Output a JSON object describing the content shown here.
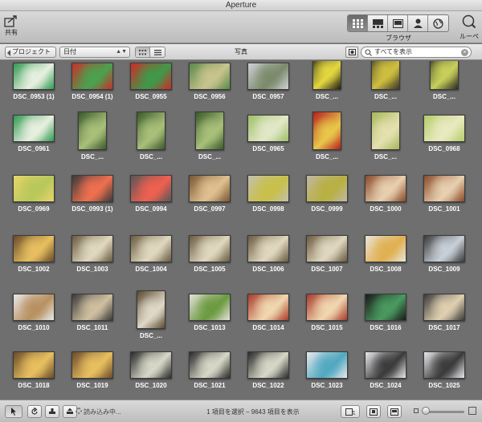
{
  "window": {
    "title": "Aperture"
  },
  "toolbar": {
    "share_label": "共有",
    "browse_label": "ブラウザ",
    "loupe_label": "ルーペ",
    "view_modes": [
      {
        "name": "grid-view-button",
        "icon": "grid-icon",
        "active": true
      },
      {
        "name": "filmstrip-view-button",
        "icon": "filmstrip-icon",
        "active": false
      },
      {
        "name": "viewer-view-button",
        "icon": "viewer-icon",
        "active": false
      },
      {
        "name": "faces-view-button",
        "icon": "person-icon",
        "active": false
      },
      {
        "name": "places-view-button",
        "icon": "globe-icon",
        "active": false
      }
    ]
  },
  "pathbar": {
    "back_label": "プロジェクト",
    "sort_value": "日付",
    "title": "写真",
    "search_placeholder": "すべてを表示"
  },
  "photos": [
    {
      "label": "DSC_0953 (1)",
      "tone": [
        "#2f9a52",
        "#e8f0e0"
      ]
    },
    {
      "label": "DSC_0954 (1)",
      "tone": [
        "#c8302a",
        "#4aa24f"
      ]
    },
    {
      "label": "DSC_0955",
      "tone": [
        "#d02a28",
        "#3e9a4a"
      ]
    },
    {
      "label": "DSC_0956",
      "tone": [
        "#5a8a4a",
        "#c9c48e"
      ]
    },
    {
      "label": "DSC_0957",
      "tone": [
        "#cfd0d5",
        "#7a8a6a"
      ]
    },
    {
      "label": "DSC_...",
      "tone": [
        "#1f1c12",
        "#e4d840"
      ]
    },
    {
      "label": "DSC_...",
      "tone": [
        "#3a3426",
        "#d0c040"
      ]
    },
    {
      "label": "DSC_...",
      "tone": [
        "#2a2a20",
        "#c9d05a"
      ]
    },
    {
      "label": "DSC_0961",
      "tone": [
        "#2f9a52",
        "#e8f0e0"
      ]
    },
    {
      "label": "DSC_...",
      "tone": [
        "#3a5a2a",
        "#a9c07a"
      ]
    },
    {
      "label": "DSC_...",
      "tone": [
        "#3a5a2a",
        "#a9c07a"
      ]
    },
    {
      "label": "DSC_...",
      "tone": [
        "#3a5a2a",
        "#a9c07a"
      ]
    },
    {
      "label": "DSC_0965",
      "tone": [
        "#9fbf6a",
        "#e2e8c8"
      ]
    },
    {
      "label": "DSC_...",
      "tone": [
        "#b81e1e",
        "#e8c84a"
      ]
    },
    {
      "label": "DSC_...",
      "tone": [
        "#a6b85a",
        "#e5e0b0"
      ]
    },
    {
      "label": "DSC_0968",
      "tone": [
        "#b6cc6a",
        "#e8eac0"
      ]
    },
    {
      "label": "DSC_0969",
      "tone": [
        "#e8d46a",
        "#b8c85a"
      ]
    },
    {
      "label": "DSC_0993 (1)",
      "tone": [
        "#3a3a3a",
        "#f07050"
      ]
    },
    {
      "label": "DSC_0994",
      "tone": [
        "#5a5656",
        "#f06050"
      ]
    },
    {
      "label": "DSC_0997",
      "tone": [
        "#7a5632",
        "#e0c090"
      ]
    },
    {
      "label": "DSC_0998",
      "tone": [
        "#c4c0aa",
        "#c8c048"
      ]
    },
    {
      "label": "DSC_0999",
      "tone": [
        "#c0b8a0",
        "#b8b040"
      ]
    },
    {
      "label": "DSC_1000",
      "tone": [
        "#8a4a2a",
        "#e8d0b0"
      ]
    },
    {
      "label": "DSC_1001",
      "tone": [
        "#8a4a2a",
        "#e8d0b0"
      ]
    },
    {
      "label": "DSC_1002",
      "tone": [
        "#6a4a2a",
        "#e8c060"
      ]
    },
    {
      "label": "DSC_1003",
      "tone": [
        "#6a5a40",
        "#e0d8c0"
      ]
    },
    {
      "label": "DSC_1004",
      "tone": [
        "#6a5a40",
        "#e0d8c0"
      ]
    },
    {
      "label": "DSC_1005",
      "tone": [
        "#6a5a40",
        "#e0d8c0"
      ]
    },
    {
      "label": "DSC_1006",
      "tone": [
        "#6a5a40",
        "#e0d8c0"
      ]
    },
    {
      "label": "DSC_1007",
      "tone": [
        "#6a5a40",
        "#e0d8c0"
      ]
    },
    {
      "label": "DSC_1008",
      "tone": [
        "#e8e4d8",
        "#e0b050"
      ]
    },
    {
      "label": "DSC_1009",
      "tone": [
        "#3a3a3a",
        "#c8d0d8"
      ]
    },
    {
      "label": "DSC_1010",
      "tone": [
        "#e8e8e8",
        "#b89060"
      ]
    },
    {
      "label": "DSC_1011",
      "tone": [
        "#3a3a3a",
        "#d0c0a0"
      ]
    },
    {
      "label": "DSC_...",
      "tone": [
        "#5a4a30",
        "#e0d8c8"
      ]
    },
    {
      "label": "DSC_1013",
      "tone": [
        "#e4e0d8",
        "#6a9a40"
      ]
    },
    {
      "label": "DSC_1014",
      "tone": [
        "#a83a2a",
        "#f0d8b0"
      ]
    },
    {
      "label": "DSC_1015",
      "tone": [
        "#a83a2a",
        "#f0d8b0"
      ]
    },
    {
      "label": "DSC_1016",
      "tone": [
        "#1a1a1a",
        "#4a9a60"
      ]
    },
    {
      "label": "DSC_1017",
      "tone": [
        "#3a3a3a",
        "#e0d0b0"
      ]
    },
    {
      "label": "DSC_1018",
      "tone": [
        "#6a4a2a",
        "#e8c060"
      ]
    },
    {
      "label": "DSC_1019",
      "tone": [
        "#6a4a2a",
        "#e8c060"
      ]
    },
    {
      "label": "DSC_1020",
      "tone": [
        "#2a2a2a",
        "#d8d8c8"
      ]
    },
    {
      "label": "DSC_1021",
      "tone": [
        "#2a2a2a",
        "#d8d8c8"
      ]
    },
    {
      "label": "DSC_1022",
      "tone": [
        "#2a2a2a",
        "#d8d8c8"
      ]
    },
    {
      "label": "DSC_1023",
      "tone": [
        "#e8e8ec",
        "#50a8c0"
      ]
    },
    {
      "label": "DSC_1024",
      "tone": [
        "#e8e8ec",
        "#3a3a3a"
      ]
    },
    {
      "label": "DSC_1025",
      "tone": [
        "#e8e8ec",
        "#3a3a3a"
      ]
    }
  ],
  "status": {
    "loading_text": "読み込み中...",
    "selection_text": "1 項目を選択 – 9643 項目を表示"
  }
}
